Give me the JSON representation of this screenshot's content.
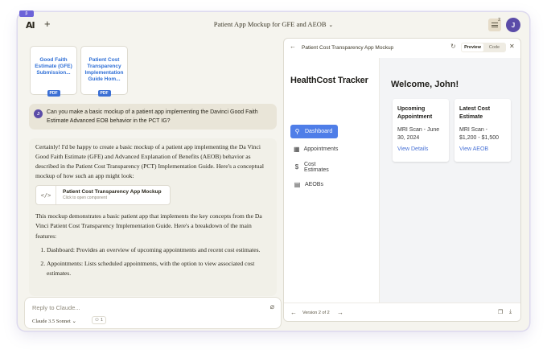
{
  "window": {
    "beta_badge": "β",
    "title": "Patient App Mockup for GFE and AEOB",
    "notification_count": "2",
    "avatar_initial": "J",
    "logo": "AI"
  },
  "files": [
    {
      "name": "Good Faith Estimate (GFE) Submission...",
      "type": "PDF"
    },
    {
      "name": "Patient Cost Transparency Implementation Guide Hom...",
      "type": "PDF"
    }
  ],
  "user_message": {
    "avatar_initial": "J",
    "text": "Can you make a basic mockup of a patient app implementing the Davinci Good Faith Estimate Advanced EOB behavior in the PCT IG?"
  },
  "assistant_reply": {
    "intro": "Certainly! I'd be happy to create a basic mockup of a patient app implementing the Da Vinci Good Faith Estimate (GFE) and Advanced Explanation of Benefits (AEOB) behavior as described in the Patient Cost Transparency (PCT) Implementation Guide. Here's a conceptual mockup of how such an app might look:",
    "artifact": {
      "title": "Patient Cost Transparency App Mockup",
      "subtitle": "Click to open component"
    },
    "body": "This mockup demonstrates a basic patient app that implements the key concepts from the Da Vinci Patient Cost Transparency Implementation Guide. Here's a breakdown of the main features:",
    "list": [
      "Dashboard: Provides an overview of upcoming appointments and recent cost estimates.",
      "Appointments: Lists scheduled appointments, with the option to view associated cost estimates."
    ]
  },
  "composer": {
    "placeholder": "Reply to Claude...",
    "model": "Claude 3.5 Sonnet",
    "people_count": "1"
  },
  "artifact_panel": {
    "title": "Patient Cost Transparency App Mockup",
    "tabs": [
      "Preview",
      "Code"
    ],
    "active_tab": "Preview",
    "version": "Version 2 of 2",
    "app": {
      "brand": "HealthCost Tracker",
      "nav": [
        {
          "label": "Dashboard",
          "icon": "user-icon",
          "active": true
        },
        {
          "label": "Appointments",
          "icon": "calendar-icon",
          "active": false
        },
        {
          "label": "Cost Estimates",
          "icon": "dollar-icon",
          "active": false
        },
        {
          "label": "AEOBs",
          "icon": "document-icon",
          "active": false
        }
      ],
      "welcome": "Welcome, John!",
      "cards": [
        {
          "title": "Upcoming Appointment",
          "value": "MRI Scan - June 30, 2024",
          "link": "View Details"
        },
        {
          "title": "Latest Cost Estimate",
          "value": "MRI Scan - $1,200 - $1,500",
          "link": "View AEOB"
        }
      ]
    }
  },
  "colors": {
    "accent": "#4f7ee8",
    "link": "#2f6fd6",
    "avatar": "#5b4ca8",
    "background": "#f5f4ee"
  }
}
